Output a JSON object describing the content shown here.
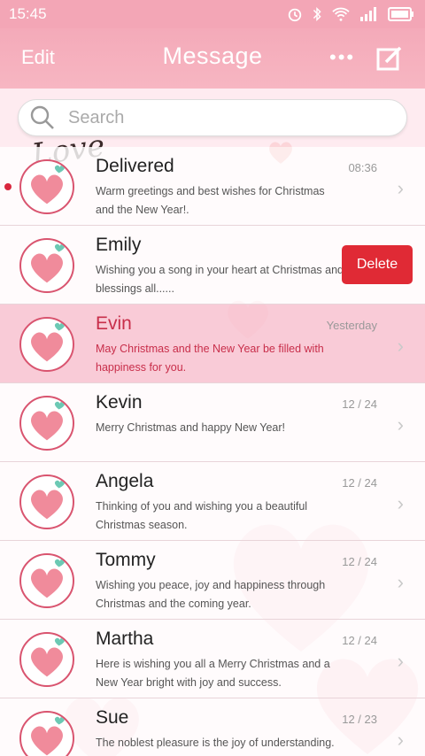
{
  "status_bar": {
    "time": "15:45",
    "icons": [
      "alarm-icon",
      "bluetooth-icon",
      "wifi-icon",
      "signal-icon",
      "battery-icon"
    ]
  },
  "header": {
    "edit_label": "Edit",
    "title": "Message",
    "more_icon": "more-icon",
    "compose_icon": "compose-icon"
  },
  "search": {
    "placeholder": "Search"
  },
  "messages": [
    {
      "name": "Delivered",
      "preview": "Warm greetings and best wishes for Christmas and the New Year!.",
      "time": "08:36",
      "unread": true
    },
    {
      "name": "Emily",
      "preview": "Wishing you a song in your heart at Christmas and blessings all......",
      "time": "",
      "action": "Delete"
    },
    {
      "name": "Evin",
      "preview": "May Christmas and the New Year be filled with happiness for you.",
      "time": "Yesterday",
      "selected": true
    },
    {
      "name": "Kevin",
      "preview": "Merry Christmas and happy New Year!",
      "time": "12 / 24"
    },
    {
      "name": "Angela",
      "preview": "Thinking of you and wishing you a beautiful Christmas season.",
      "time": "12 / 24"
    },
    {
      "name": "Tommy",
      "preview": "Wishing you peace, joy and happiness through Christmas and the coming year.",
      "time": "12 / 24"
    },
    {
      "name": "Martha",
      "preview": "Here is wishing you all a Merry Christmas and a New Year bright with joy and success.",
      "time": "12 / 24"
    },
    {
      "name": "Sue",
      "preview": "The noblest pleasure is the joy of understanding.",
      "time": "12 / 23"
    }
  ],
  "decor": {
    "love_script": "Love"
  },
  "colors": {
    "accent": "#f3a6b6",
    "delete": "#e02a35",
    "selected_text": "#c82e4a",
    "unread_dot": "#d9263d"
  }
}
